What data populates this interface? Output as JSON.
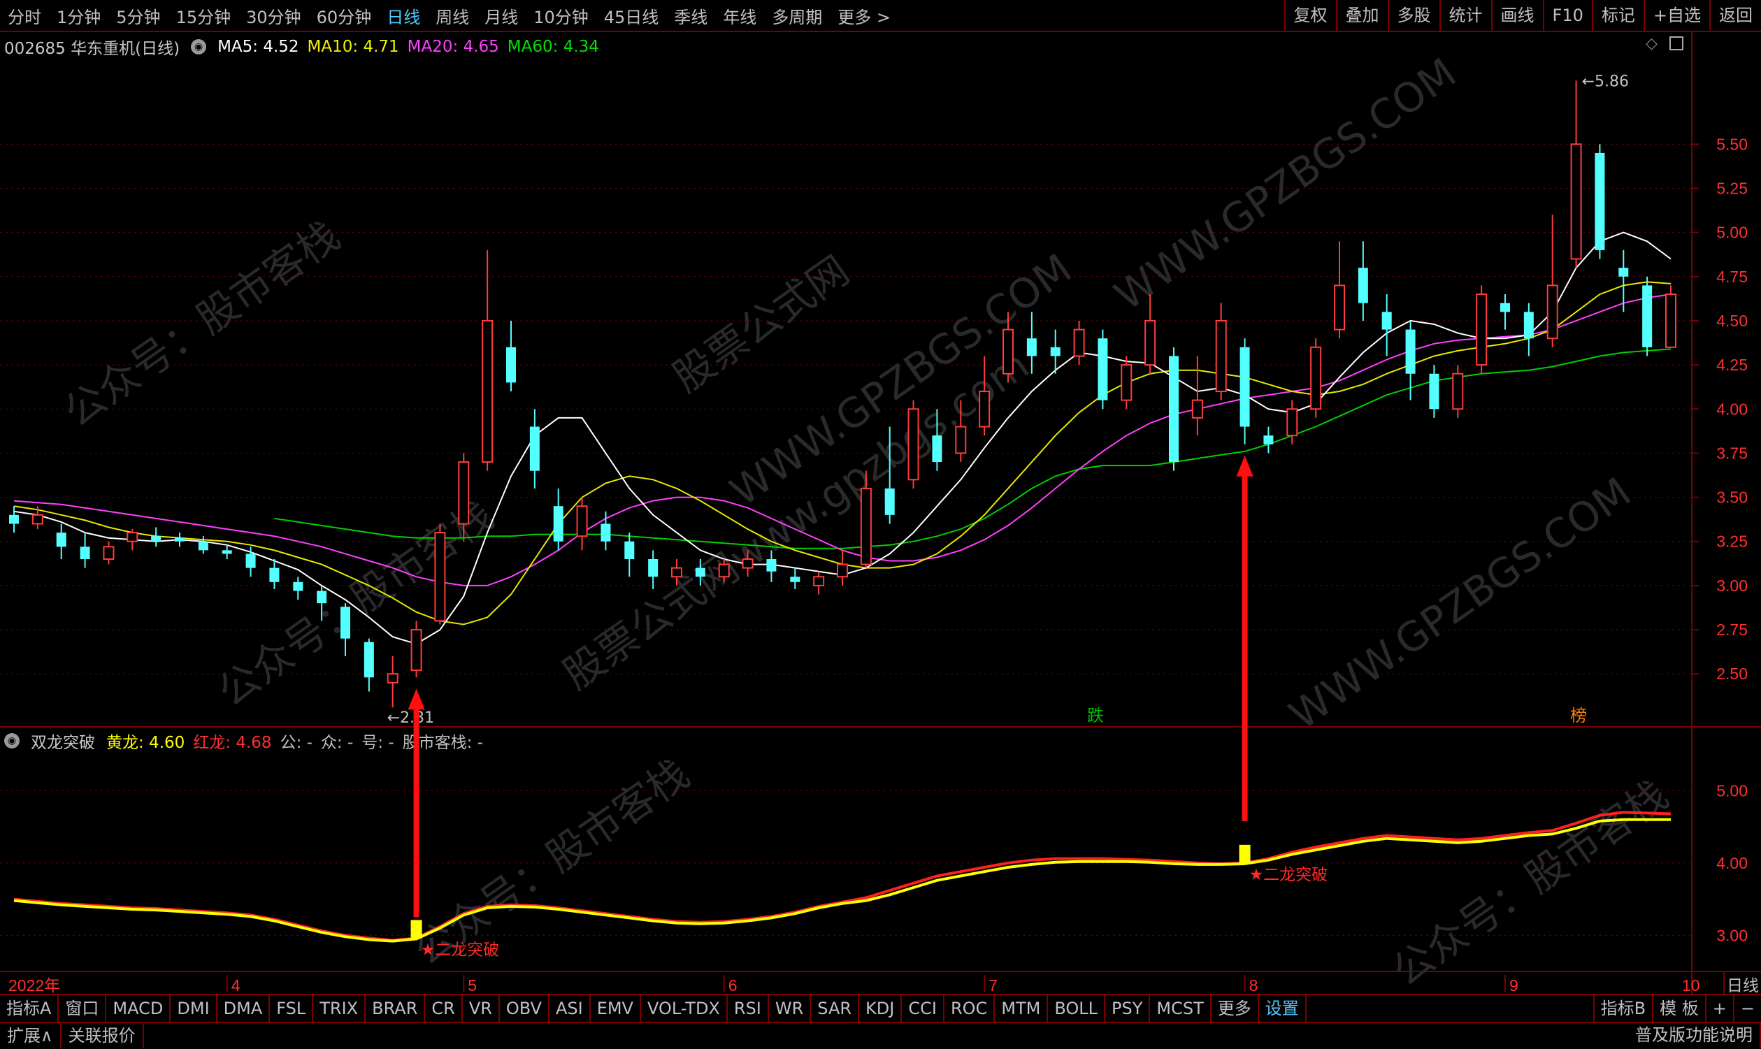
{
  "periods": [
    "分时",
    "1分钟",
    "5分钟",
    "15分钟",
    "30分钟",
    "60分钟",
    "日线",
    "周线",
    "月线",
    "10分钟",
    "45日线",
    "季线",
    "年线",
    "多周期",
    "更多 >"
  ],
  "active_period": "日线",
  "tools": [
    "复权",
    "叠加",
    "多股",
    "统计",
    "画线",
    "F10",
    "标记",
    "+自选",
    "返回"
  ],
  "stock_title": "002685 华东重机(日线)",
  "ma_legend": [
    {
      "label": "MA5: 4.52",
      "color": "#ffffff"
    },
    {
      "label": "MA10: 4.71",
      "color": "#f0f000"
    },
    {
      "label": "MA20: 4.65",
      "color": "#ff40ff"
    },
    {
      "label": "MA60: 4.34",
      "color": "#00e000"
    }
  ],
  "ind_title": "双龙突破",
  "ind_legend": [
    {
      "label": "黄龙: 4.60",
      "color": "#ffff00"
    },
    {
      "label": "红龙: 4.68",
      "color": "#ff3030"
    },
    {
      "label": "公: -",
      "color": "#c0c0c0"
    },
    {
      "label": "众: -",
      "color": "#c0c0c0"
    },
    {
      "label": "号: -",
      "color": "#c0c0c0"
    },
    {
      "label": "股市客栈: -",
      "color": "#c0c0c0"
    }
  ],
  "chart_data": {
    "type": "candlestick",
    "price_axis": [
      "5.50",
      "5.25",
      "5.00",
      "4.75",
      "4.50",
      "4.25",
      "4.00",
      "3.75",
      "3.50",
      "3.25",
      "3.00",
      "2.75",
      "2.50"
    ],
    "ind_axis": [
      "5.00",
      "4.00",
      "3.00"
    ],
    "high_label": "5.86",
    "low_label": "2.31",
    "time_labels": [
      "2022年",
      "4",
      "5",
      "6",
      "7",
      "8",
      "9",
      "10"
    ],
    "unit_label": "日线",
    "markers": [
      "跌",
      "榜"
    ],
    "signal_text": "★二龙突破",
    "candles": [
      [
        3.4,
        3.35,
        3.45,
        3.3
      ],
      [
        3.35,
        3.4,
        3.45,
        3.32
      ],
      [
        3.3,
        3.22,
        3.35,
        3.15
      ],
      [
        3.22,
        3.15,
        3.3,
        3.1
      ],
      [
        3.15,
        3.22,
        3.25,
        3.12
      ],
      [
        3.25,
        3.3,
        3.32,
        3.2
      ],
      [
        3.28,
        3.25,
        3.33,
        3.22
      ],
      [
        3.27,
        3.25,
        3.3,
        3.22
      ],
      [
        3.25,
        3.2,
        3.28,
        3.18
      ],
      [
        3.2,
        3.18,
        3.23,
        3.15
      ],
      [
        3.18,
        3.1,
        3.22,
        3.05
      ],
      [
        3.1,
        3.02,
        3.15,
        2.98
      ],
      [
        3.02,
        2.97,
        3.05,
        2.92
      ],
      [
        2.97,
        2.9,
        3.0,
        2.8
      ],
      [
        2.88,
        2.7,
        2.9,
        2.6
      ],
      [
        2.68,
        2.48,
        2.7,
        2.4
      ],
      [
        2.45,
        2.5,
        2.6,
        2.31
      ],
      [
        2.52,
        2.75,
        2.8,
        2.48
      ],
      [
        2.8,
        3.3,
        3.35,
        2.78
      ],
      [
        3.35,
        3.7,
        3.75,
        3.25
      ],
      [
        3.7,
        4.5,
        4.9,
        3.65
      ],
      [
        4.35,
        4.15,
        4.5,
        4.1
      ],
      [
        3.9,
        3.65,
        4.0,
        3.55
      ],
      [
        3.45,
        3.25,
        3.55,
        3.2
      ],
      [
        3.28,
        3.45,
        3.5,
        3.2
      ],
      [
        3.35,
        3.25,
        3.42,
        3.2
      ],
      [
        3.25,
        3.15,
        3.3,
        3.05
      ],
      [
        3.15,
        3.05,
        3.2,
        2.98
      ],
      [
        3.05,
        3.1,
        3.15,
        3.0
      ],
      [
        3.1,
        3.05,
        3.15,
        3.0
      ],
      [
        3.05,
        3.12,
        3.15,
        3.02
      ],
      [
        3.1,
        3.15,
        3.2,
        3.05
      ],
      [
        3.15,
        3.08,
        3.2,
        3.02
      ],
      [
        3.05,
        3.02,
        3.1,
        2.98
      ],
      [
        3.0,
        3.05,
        3.08,
        2.95
      ],
      [
        3.05,
        3.12,
        3.2,
        3.0
      ],
      [
        3.12,
        3.55,
        3.65,
        3.1
      ],
      [
        3.55,
        3.4,
        3.9,
        3.35
      ],
      [
        3.6,
        4.0,
        4.05,
        3.55
      ],
      [
        3.85,
        3.7,
        4.0,
        3.65
      ],
      [
        3.75,
        3.9,
        4.05,
        3.7
      ],
      [
        3.9,
        4.1,
        4.3,
        3.85
      ],
      [
        4.2,
        4.45,
        4.55,
        4.15
      ],
      [
        4.4,
        4.3,
        4.55,
        4.2
      ],
      [
        4.35,
        4.3,
        4.45,
        4.2
      ],
      [
        4.3,
        4.45,
        4.5,
        4.25
      ],
      [
        4.4,
        4.05,
        4.45,
        4.0
      ],
      [
        4.05,
        4.25,
        4.3,
        4.0
      ],
      [
        4.25,
        4.5,
        4.65,
        4.2
      ],
      [
        4.3,
        3.7,
        4.35,
        3.65
      ],
      [
        3.95,
        4.05,
        4.3,
        3.85
      ],
      [
        4.1,
        4.5,
        4.6,
        4.05
      ],
      [
        4.35,
        3.9,
        4.4,
        3.8
      ],
      [
        3.85,
        3.8,
        3.9,
        3.75
      ],
      [
        3.85,
        4.0,
        4.05,
        3.8
      ],
      [
        4.0,
        4.35,
        4.4,
        3.95
      ],
      [
        4.45,
        4.7,
        4.95,
        4.4
      ],
      [
        4.8,
        4.6,
        4.95,
        4.5
      ],
      [
        4.55,
        4.45,
        4.65,
        4.3
      ],
      [
        4.45,
        4.2,
        4.5,
        4.05
      ],
      [
        4.2,
        4.0,
        4.25,
        3.95
      ],
      [
        4.0,
        4.2,
        4.25,
        3.95
      ],
      [
        4.25,
        4.65,
        4.7,
        4.2
      ],
      [
        4.6,
        4.55,
        4.65,
        4.45
      ],
      [
        4.55,
        4.4,
        4.6,
        4.3
      ],
      [
        4.4,
        4.7,
        5.1,
        4.35
      ],
      [
        4.85,
        5.5,
        5.86,
        4.8
      ],
      [
        5.45,
        4.9,
        5.5,
        4.85
      ],
      [
        4.8,
        4.75,
        4.9,
        4.55
      ],
      [
        4.7,
        4.35,
        4.75,
        4.3
      ],
      [
        4.35,
        4.65,
        4.7,
        4.35
      ]
    ],
    "ma5": [
      3.42,
      3.4,
      3.36,
      3.3,
      3.27,
      3.26,
      3.25,
      3.26,
      3.25,
      3.23,
      3.19,
      3.14,
      3.09,
      3.0,
      2.92,
      2.82,
      2.71,
      2.67,
      2.75,
      2.94,
      3.3,
      3.62,
      3.85,
      3.95,
      3.95,
      3.75,
      3.55,
      3.4,
      3.3,
      3.2,
      3.15,
      3.12,
      3.12,
      3.1,
      3.08,
      3.06,
      3.1,
      3.18,
      3.3,
      3.45,
      3.6,
      3.78,
      3.95,
      4.1,
      4.22,
      4.32,
      4.3,
      4.27,
      4.26,
      4.18,
      4.1,
      4.12,
      4.08,
      4.0,
      3.98,
      4.03,
      4.18,
      4.32,
      4.43,
      4.5,
      4.48,
      4.43,
      4.4,
      4.4,
      4.42,
      4.55,
      4.8,
      4.95,
      5.0,
      4.95,
      4.85
    ],
    "ma10": [
      3.45,
      3.43,
      3.4,
      3.37,
      3.33,
      3.3,
      3.28,
      3.27,
      3.26,
      3.25,
      3.23,
      3.2,
      3.16,
      3.12,
      3.06,
      3.0,
      2.93,
      2.85,
      2.8,
      2.78,
      2.82,
      2.95,
      3.15,
      3.35,
      3.5,
      3.58,
      3.62,
      3.6,
      3.55,
      3.48,
      3.4,
      3.32,
      3.25,
      3.2,
      3.16,
      3.12,
      3.1,
      3.1,
      3.12,
      3.18,
      3.28,
      3.4,
      3.55,
      3.7,
      3.85,
      3.98,
      4.08,
      4.15,
      4.2,
      4.22,
      4.22,
      4.2,
      4.18,
      4.14,
      4.1,
      4.08,
      4.1,
      4.14,
      4.2,
      4.25,
      4.3,
      4.33,
      4.35,
      4.37,
      4.4,
      4.45,
      4.55,
      4.65,
      4.7,
      4.72,
      4.71
    ],
    "ma20": [
      3.48,
      3.47,
      3.46,
      3.44,
      3.42,
      3.4,
      3.38,
      3.36,
      3.34,
      3.32,
      3.3,
      3.28,
      3.25,
      3.22,
      3.18,
      3.14,
      3.1,
      3.05,
      3.02,
      3.0,
      3.0,
      3.05,
      3.12,
      3.2,
      3.3,
      3.38,
      3.44,
      3.48,
      3.5,
      3.5,
      3.48,
      3.44,
      3.38,
      3.32,
      3.26,
      3.2,
      3.16,
      3.14,
      3.14,
      3.16,
      3.2,
      3.26,
      3.34,
      3.44,
      3.55,
      3.66,
      3.76,
      3.85,
      3.92,
      3.97,
      4.0,
      4.03,
      4.06,
      4.08,
      4.1,
      4.12,
      4.16,
      4.22,
      4.28,
      4.33,
      4.37,
      4.39,
      4.4,
      4.41,
      4.42,
      4.45,
      4.5,
      4.55,
      4.6,
      4.63,
      4.65
    ],
    "ma60": [
      null,
      null,
      null,
      null,
      null,
      null,
      null,
      null,
      null,
      null,
      null,
      3.38,
      3.36,
      3.34,
      3.32,
      3.3,
      3.28,
      3.27,
      3.27,
      3.27,
      3.28,
      3.28,
      3.29,
      3.29,
      3.29,
      3.29,
      3.28,
      3.27,
      3.26,
      3.25,
      3.24,
      3.23,
      3.22,
      3.21,
      3.21,
      3.21,
      3.22,
      3.23,
      3.25,
      3.28,
      3.32,
      3.38,
      3.46,
      3.55,
      3.62,
      3.66,
      3.68,
      3.68,
      3.68,
      3.7,
      3.72,
      3.74,
      3.76,
      3.8,
      3.85,
      3.9,
      3.96,
      4.02,
      4.08,
      4.12,
      4.16,
      4.18,
      4.2,
      4.21,
      4.22,
      4.24,
      4.27,
      4.3,
      4.32,
      4.33,
      4.34
    ],
    "yellow_dragon": [
      3.48,
      3.45,
      3.42,
      3.4,
      3.38,
      3.36,
      3.35,
      3.33,
      3.31,
      3.29,
      3.26,
      3.2,
      3.12,
      3.04,
      2.98,
      2.94,
      2.92,
      2.95,
      3.1,
      3.28,
      3.38,
      3.4,
      3.39,
      3.36,
      3.32,
      3.28,
      3.24,
      3.2,
      3.17,
      3.16,
      3.17,
      3.2,
      3.24,
      3.3,
      3.38,
      3.44,
      3.48,
      3.56,
      3.66,
      3.76,
      3.82,
      3.88,
      3.94,
      3.98,
      4.01,
      4.02,
      4.02,
      4.02,
      4.01,
      3.99,
      3.98,
      3.98,
      3.99,
      4.04,
      4.12,
      4.18,
      4.24,
      4.3,
      4.34,
      4.32,
      4.3,
      4.28,
      4.3,
      4.34,
      4.38,
      4.4,
      4.48,
      4.58,
      4.6,
      4.6,
      4.6
    ],
    "red_dragon": [
      3.5,
      3.47,
      3.44,
      3.42,
      3.4,
      3.38,
      3.37,
      3.35,
      3.33,
      3.31,
      3.28,
      3.22,
      3.14,
      3.06,
      3.0,
      2.96,
      2.93,
      2.96,
      3.12,
      3.3,
      3.4,
      3.42,
      3.41,
      3.38,
      3.34,
      3.3,
      3.26,
      3.22,
      3.19,
      3.18,
      3.19,
      3.22,
      3.26,
      3.32,
      3.4,
      3.46,
      3.52,
      3.62,
      3.72,
      3.82,
      3.88,
      3.94,
      4.0,
      4.04,
      4.06,
      4.06,
      4.06,
      4.05,
      4.04,
      4.02,
      4.0,
      3.99,
      4.0,
      4.06,
      4.15,
      4.22,
      4.28,
      4.34,
      4.38,
      4.36,
      4.34,
      4.32,
      4.34,
      4.38,
      4.42,
      4.45,
      4.55,
      4.66,
      4.7,
      4.69,
      4.68
    ],
    "signals": [
      17,
      52
    ]
  },
  "indicators": [
    "指标A",
    "窗口",
    "MACD",
    "DMI",
    "DMA",
    "FSL",
    "TRIX",
    "BRAR",
    "CR",
    "VR",
    "OBV",
    "ASI",
    "EMV",
    "VOL-TDX",
    "RSI",
    "WR",
    "SAR",
    "KDJ",
    "CCI",
    "ROC",
    "MTM",
    "BOLL",
    "PSY",
    "MCST",
    "更多",
    "设置"
  ],
  "indicator_right": [
    "指标B",
    "模 板",
    "+",
    "−"
  ],
  "bottom_left": [
    "扩展∧",
    "关联报价"
  ],
  "bottom_right": "普及版功能说明",
  "watermarks": [
    "公众号：股市客栈",
    "WWW.GPZBGS.COM",
    "股票公式网",
    "股票公式网www.gpzbgs.com"
  ]
}
